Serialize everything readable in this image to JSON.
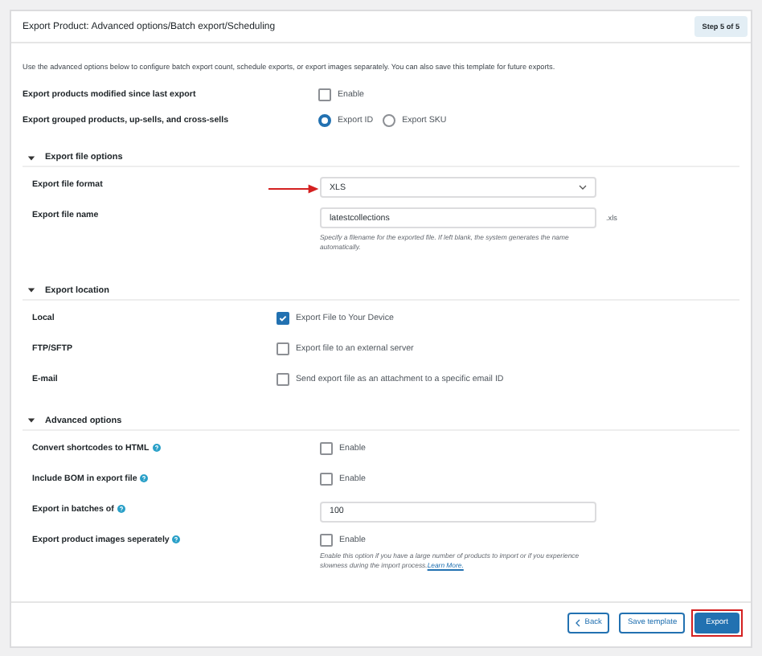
{
  "header": {
    "title": "Export Product: Advanced options/Batch export/Scheduling",
    "step": "Step 5 of 5"
  },
  "description": "Use the advanced options below to configure batch export count, schedule exports, or export images separately. You can also save this template for future exports.",
  "top_rows": [
    {
      "label": "Export products modified since last export",
      "kind": "checkbox",
      "option": "Enable",
      "checked": false
    },
    {
      "label": "Export grouped products, up-sells, and cross-sells",
      "kind": "radio",
      "options": [
        {
          "label": "Export ID",
          "selected": true
        },
        {
          "label": "Export SKU",
          "selected": false
        }
      ]
    }
  ],
  "sections": [
    {
      "title": "Export file options",
      "expanded": true,
      "rows": [
        {
          "label": "Export file format",
          "kind": "select",
          "value": "XLS",
          "pointer": true
        },
        {
          "label": "Export file name",
          "kind": "text",
          "value": "latestcollections",
          "suffix": ".xls",
          "hint": "Specify a filename for the exported file. If left blank, the system generates the name automatically."
        }
      ]
    },
    {
      "title": "Export location",
      "expanded": true,
      "rows": [
        {
          "label": "Local",
          "kind": "destination",
          "option": "Export File to Your Device",
          "checked": true
        },
        {
          "label": "FTP/SFTP",
          "kind": "destination",
          "option": "Export file to an external server",
          "checked": false
        },
        {
          "label": "E-mail",
          "kind": "destination",
          "option": "Send export file as an attachment to a specific email ID",
          "checked": false
        }
      ]
    },
    {
      "title": "Advanced options",
      "expanded": true,
      "rows": [
        {
          "label": "Convert shortcodes to HTML",
          "help": true,
          "kind": "checkbox",
          "option": "Enable",
          "checked": false
        },
        {
          "label": "Include BOM in export file",
          "help": true,
          "kind": "checkbox",
          "option": "Enable",
          "checked": false
        },
        {
          "label": "Export in batches of",
          "help": true,
          "kind": "text",
          "value": "100"
        },
        {
          "label": "Export product images seperately",
          "help": true,
          "kind": "checkbox",
          "option": "Enable",
          "checked": false,
          "hint": "Enable this option if you have a large number of products to import or if you experience slowness during the import process.",
          "link": "Learn More."
        }
      ]
    }
  ],
  "buttons": [
    {
      "label": "Back",
      "kind": "back",
      "highlighted": false
    },
    {
      "label": "Save template",
      "kind": "secondary",
      "highlighted": false
    },
    {
      "label": "Export",
      "kind": "primary",
      "highlighted": true
    }
  ]
}
